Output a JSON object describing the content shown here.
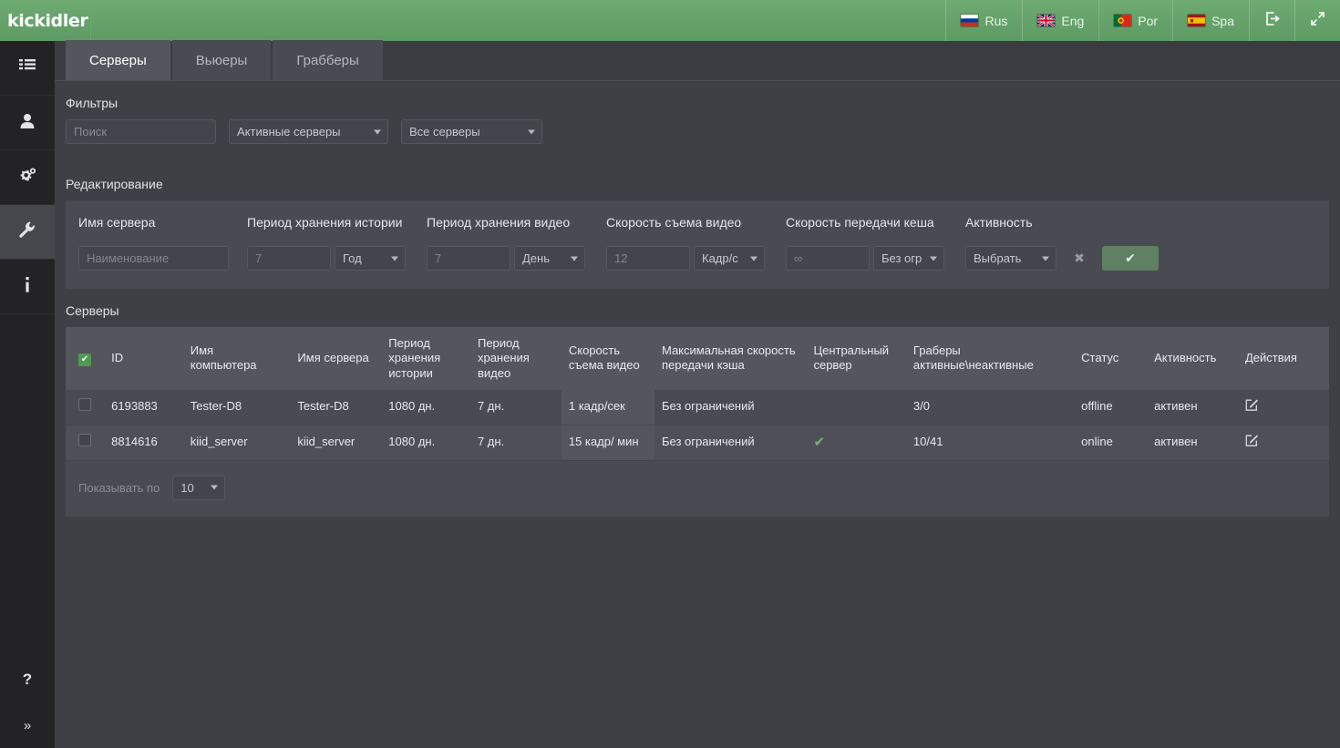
{
  "app": {
    "logo": "kickidler"
  },
  "topbar": {
    "languages": [
      {
        "code": "rus",
        "label": "Rus",
        "flag": "ru"
      },
      {
        "code": "eng",
        "label": "Eng",
        "flag": "gb"
      },
      {
        "code": "por",
        "label": "Por",
        "flag": "pt"
      },
      {
        "code": "spa",
        "label": "Spa",
        "flag": "es"
      }
    ],
    "logout_icon": "logout-icon",
    "fullscreen_icon": "fullscreen-icon"
  },
  "sidebar": {
    "items": [
      {
        "name": "list",
        "icon": "list-icon",
        "active": false
      },
      {
        "name": "users",
        "icon": "user-icon",
        "active": false
      },
      {
        "name": "config",
        "icon": "gears-icon",
        "active": false
      },
      {
        "name": "tools",
        "icon": "wrench-icon",
        "active": true
      },
      {
        "name": "info",
        "icon": "info-icon",
        "active": false
      }
    ],
    "bottom": [
      {
        "name": "help",
        "icon": "question-icon"
      },
      {
        "name": "expand",
        "icon": "double-chevron-right-icon"
      }
    ]
  },
  "tabs": [
    {
      "label": "Серверы",
      "active": true
    },
    {
      "label": "Вьюеры",
      "active": false
    },
    {
      "label": "Грабберы",
      "active": false
    }
  ],
  "filters": {
    "title": "Фильтры",
    "search_placeholder": "Поиск",
    "search_value": "",
    "status_select": "Активные серверы",
    "scope_select": "Все серверы"
  },
  "editing": {
    "title": "Редактирование",
    "columns": [
      {
        "label": "Имя сервера"
      },
      {
        "label": "Период хранения истории"
      },
      {
        "label": "Период хранения видео"
      },
      {
        "label": "Скорость съема видео"
      },
      {
        "label": "Скорость передачи кеша"
      },
      {
        "label": "Активность"
      }
    ],
    "server_name_placeholder": "Наименование",
    "history_value": "7",
    "history_unit": "Год",
    "video_value": "7",
    "video_unit": "День",
    "capture_value": "12",
    "capture_unit": "Кадр/с",
    "cache_value": "∞",
    "cache_unit": "Без огр",
    "activity_select": "Выбрать",
    "cancel_icon": "close-icon",
    "confirm_icon": "check-icon"
  },
  "servers": {
    "title": "Серверы",
    "headers": [
      "",
      "ID",
      "Имя компьютера",
      "Имя сервера",
      "Период хранения истории",
      "Период хранения видео",
      "Скорость съема видео",
      "Максимальная скорость передачи кэша",
      "Центральный сервер",
      "Граберы активные\\неактивные",
      "Статус",
      "Активность",
      "Действия"
    ],
    "header_checkbox_checked": true,
    "rows": [
      {
        "selected": false,
        "id": "6193883",
        "computer_name": "Tester-D8",
        "server_name": "Tester-D8",
        "history_period": "1080 дн.",
        "video_period": "7 дн.",
        "capture_speed": "1 кадр/сек",
        "max_cache_speed": "Без ограничений",
        "central_server": false,
        "grabbers": "3/0",
        "status": "offline",
        "activity": "активен",
        "action_icon": "edit-icon"
      },
      {
        "selected": false,
        "id": "8814616",
        "computer_name": "kiid_server",
        "server_name": "kiid_server",
        "history_period": "1080 дн.",
        "video_period": "7 дн.",
        "capture_speed": "15 кадр/ мин",
        "max_cache_speed": "Без ограничений",
        "central_server": true,
        "grabbers": "10/41",
        "status": "online",
        "activity": "активен",
        "action_icon": "edit-icon"
      }
    ]
  },
  "pager": {
    "label": "Показывать по",
    "page_size": "10"
  },
  "colors": {
    "brand_green": "#5e9b64",
    "accent_check": "#4f9a52",
    "panel": "#4a4a52",
    "panel_header": "#55555e",
    "sidebar": "#232326",
    "page_bg": "#3f3f46"
  }
}
